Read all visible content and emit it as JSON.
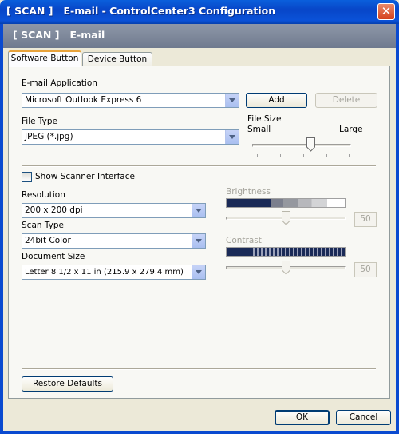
{
  "window": {
    "title": "[ SCAN ]   E-mail - ControlCenter3 Configuration",
    "close_glyph": "✕",
    "header": "[ SCAN ]   E-mail"
  },
  "tabs": [
    {
      "label": "Software Button",
      "active": true
    },
    {
      "label": "Device Button",
      "active": false
    }
  ],
  "email_application": {
    "label": "E-mail Application",
    "value": "Microsoft Outlook Express 6",
    "add_label": "Add",
    "delete_label": "Delete"
  },
  "file_type": {
    "label": "File Type",
    "value": "JPEG (*.jpg)"
  },
  "file_size": {
    "label": "File Size",
    "small_label": "Small",
    "large_label": "Large",
    "level": 0.6
  },
  "show_scanner_interface": {
    "label": "Show Scanner Interface",
    "checked": false
  },
  "resolution": {
    "label": "Resolution",
    "value": "200 x 200 dpi"
  },
  "scan_type": {
    "label": "Scan Type",
    "value": "24bit Color"
  },
  "document_size": {
    "label": "Document Size",
    "value": "Letter 8 1/2 x 11 in (215.9 x 279.4 mm)"
  },
  "brightness": {
    "label": "Brightness",
    "value": "50",
    "enabled": false
  },
  "contrast": {
    "label": "Contrast",
    "value": "50",
    "enabled": false
  },
  "restore_defaults_label": "Restore Defaults",
  "ok_label": "OK",
  "cancel_label": "Cancel",
  "colors": {
    "titlebar": "#0a52d8",
    "banner": "#7b8598",
    "dialog_bg": "#ece9d8"
  }
}
